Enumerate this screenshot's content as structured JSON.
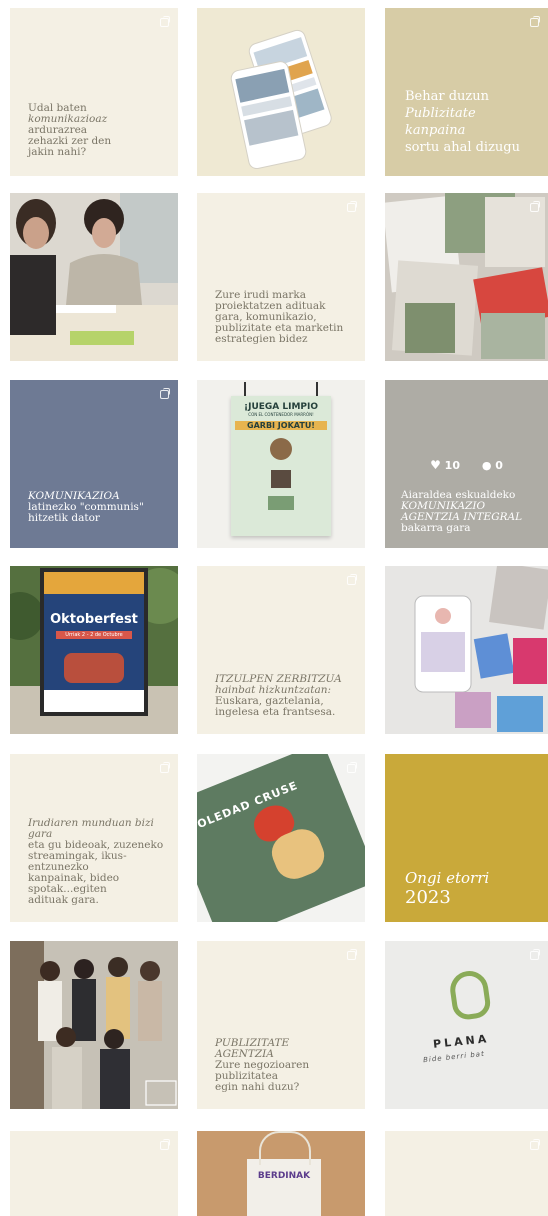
{
  "grid": {
    "tiles": [
      {
        "id": "t1",
        "lines": [
          {
            "text": "Udal baten",
            "style": "rg"
          },
          {
            "text": "komunikazioaz",
            "style": "em"
          },
          {
            "text": "ardurazrea",
            "style": "rg"
          },
          {
            "text": "zehazki zer den",
            "style": "rg"
          },
          {
            "text": "jakin nahi?",
            "style": "rg"
          }
        ]
      },
      {
        "id": "t2",
        "image": "phones-mockup"
      },
      {
        "id": "t3",
        "lines": [
          {
            "text": "Behar duzun",
            "style": "rg"
          },
          {
            "text": "Publizitate kanpaina",
            "style": "em"
          },
          {
            "text": "sortu ahal dizugu",
            "style": "rg"
          }
        ]
      },
      {
        "id": "t4",
        "image": "team-meeting-photo"
      },
      {
        "id": "t5",
        "lines": [
          {
            "text": "Zure irudi marka",
            "style": "rg"
          },
          {
            "text": "proiektatzen adituak",
            "style": "rg"
          },
          {
            "text": "gara, komunikazio,",
            "style": "rg"
          },
          {
            "text": "publizitate eta marketin",
            "style": "rg"
          },
          {
            "text": "estrategien bidez",
            "style": "rg"
          }
        ]
      },
      {
        "id": "t6",
        "image": "newspaper-collage"
      },
      {
        "id": "t7",
        "lines": [
          {
            "text": "KOMUNIKAZIOA",
            "style": "em"
          },
          {
            "text": "latinezko \"communis\"",
            "style": "rg"
          },
          {
            "text": "hitzetik dator",
            "style": "rg"
          }
        ]
      },
      {
        "id": "t8",
        "image": "juega-limpio-poster",
        "poster": {
          "title": "¡JUEGA LIMPIO",
          "subtitle": "CON EL CONTENEDOR MARRÓN!",
          "band": "GARBI JOKATU!"
        }
      },
      {
        "id": "t9",
        "likes": "10",
        "comments": "0",
        "lines": [
          {
            "text": "Aiaraldea eskualdeko",
            "style": "rg"
          },
          {
            "text": "KOMUNIKAZIO",
            "style": "em"
          },
          {
            "text": "AGENTZIA INTEGRAL",
            "style": "em"
          },
          {
            "text": "bakarra gara",
            "style": "rg"
          }
        ]
      },
      {
        "id": "t10",
        "image": "oktoberfest-poster",
        "poster": {
          "title": "Oktoberfest",
          "dates": "Urriak 2 - 2 de Octubre"
        }
      },
      {
        "id": "t11",
        "lines": [
          {
            "text": "ITZULPEN ZERBITZUA",
            "style": "em"
          },
          {
            "text": "hainbat hizkuntzatan:",
            "style": "em"
          },
          {
            "text": "Euskara, gaztelania,",
            "style": "rg"
          },
          {
            "text": "ingelesa eta frantsesa.",
            "style": "rg"
          }
        ]
      },
      {
        "id": "t12",
        "image": "social-media-mockup"
      },
      {
        "id": "t13",
        "lines": [
          {
            "text": "Irudiaren munduan bizi gara",
            "style": "em"
          },
          {
            "text": "eta gu bideoak, zuzeneko",
            "style": "rg"
          },
          {
            "text": "streamingak, ikus-entzunezko",
            "style": "rg"
          },
          {
            "text": "kanpainak, bideo spotak...egiten",
            "style": "rg"
          },
          {
            "text": "adituak gara.",
            "style": "rg"
          }
        ]
      },
      {
        "id": "t14",
        "image": "soledad-cover",
        "poster": {
          "title": "SOLEDAD CRUSE"
        }
      },
      {
        "id": "t15",
        "lines": [
          {
            "text": "Ongi etorri",
            "style": "em"
          },
          {
            "text": "2023",
            "style": "rg"
          }
        ]
      },
      {
        "id": "t16",
        "image": "group-photo"
      },
      {
        "id": "t17",
        "lines": [
          {
            "text": "PUBLIZITATE AGENTZIA",
            "style": "em"
          },
          {
            "text": "Zure negozioaren publizitatea",
            "style": "rg"
          },
          {
            "text": "egin nahi duzu?",
            "style": "rg"
          }
        ]
      },
      {
        "id": "t18",
        "logo": {
          "name": "PLANA",
          "tagline": "Bide berri bat"
        }
      },
      {
        "id": "t19",
        "blank": true
      },
      {
        "id": "t20",
        "image": "tote-bag",
        "poster": {
          "title": "BERDINAK"
        }
      },
      {
        "id": "t21",
        "blank": true
      }
    ]
  },
  "colors": {
    "cream": "#f4f0e4",
    "slate": "#6e7a94",
    "gray": "#aeaca5",
    "tan": "#d7cca6",
    "mustard": "#c9a93a"
  }
}
